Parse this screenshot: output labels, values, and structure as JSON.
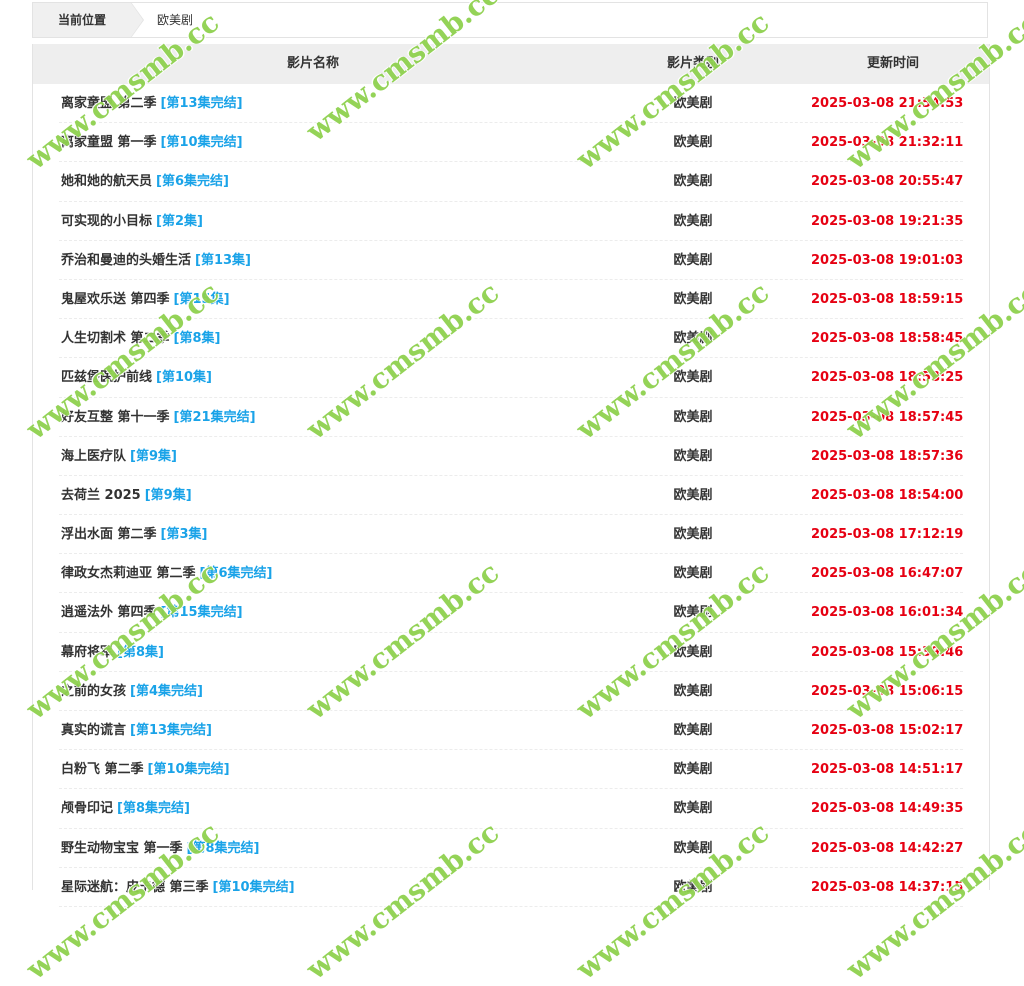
{
  "breadcrumb": {
    "label": "当前位置",
    "current": "欧美剧"
  },
  "table": {
    "headers": {
      "name": "影片名称",
      "type": "影片类别",
      "time": "更新时间"
    },
    "rows": [
      {
        "title": "离家童盟 第二季",
        "episode": "[第13集完结]",
        "type": "欧美剧",
        "time": "2025-03-08 21:54:53"
      },
      {
        "title": "离家童盟 第一季",
        "episode": "[第10集完结]",
        "type": "欧美剧",
        "time": "2025-03-08 21:32:11"
      },
      {
        "title": "她和她的航天员",
        "episode": "[第6集完结]",
        "type": "欧美剧",
        "time": "2025-03-08 20:55:47"
      },
      {
        "title": "可实现的小目标",
        "episode": "[第2集]",
        "type": "欧美剧",
        "time": "2025-03-08 19:21:35"
      },
      {
        "title": "乔治和曼迪的头婚生活",
        "episode": "[第13集]",
        "type": "欧美剧",
        "time": "2025-03-08 19:01:03"
      },
      {
        "title": "鬼屋欢乐送 第四季",
        "episode": "[第15集]",
        "type": "欧美剧",
        "time": "2025-03-08 18:59:15"
      },
      {
        "title": "人生切割术 第二季",
        "episode": "[第8集]",
        "type": "欧美剧",
        "time": "2025-03-08 18:58:45"
      },
      {
        "title": "匹兹堡医护前线",
        "episode": "[第10集]",
        "type": "欧美剧",
        "time": "2025-03-08 18:58:25"
      },
      {
        "title": "好友互整 第十一季",
        "episode": "[第21集完结]",
        "type": "欧美剧",
        "time": "2025-03-08 18:57:45"
      },
      {
        "title": "海上医疗队",
        "episode": "[第9集]",
        "type": "欧美剧",
        "time": "2025-03-08 18:57:36"
      },
      {
        "title": "去荷兰 2025",
        "episode": "[第9集]",
        "type": "欧美剧",
        "time": "2025-03-08 18:54:00"
      },
      {
        "title": "浮出水面 第二季",
        "episode": "[第3集]",
        "type": "欧美剧",
        "time": "2025-03-08 17:12:19"
      },
      {
        "title": "律政女杰莉迪亚 第二季",
        "episode": "[第6集完结]",
        "type": "欧美剧",
        "time": "2025-03-08 16:47:07"
      },
      {
        "title": "逍遥法外 第四季",
        "episode": "[第15集完结]",
        "type": "欧美剧",
        "time": "2025-03-08 16:01:34"
      },
      {
        "title": "幕府将军",
        "episode": "[第8集]",
        "type": "欧美剧",
        "time": "2025-03-08 15:39:46"
      },
      {
        "title": "之前的女孩",
        "episode": "[第4集完结]",
        "type": "欧美剧",
        "time": "2025-03-08 15:06:15"
      },
      {
        "title": "真实的谎言",
        "episode": "[第13集完结]",
        "type": "欧美剧",
        "time": "2025-03-08 15:02:17"
      },
      {
        "title": "白粉飞 第二季",
        "episode": "[第10集完结]",
        "type": "欧美剧",
        "time": "2025-03-08 14:51:17"
      },
      {
        "title": "颅骨印记",
        "episode": "[第8集完结]",
        "type": "欧美剧",
        "time": "2025-03-08 14:49:35"
      },
      {
        "title": "野生动物宝宝 第一季",
        "episode": "[第8集完结]",
        "type": "欧美剧",
        "time": "2025-03-08 14:42:27"
      },
      {
        "title": "星际迷航：皮卡德 第三季",
        "episode": "[第10集完结]",
        "type": "欧美剧",
        "time": "2025-03-08 14:37:15"
      }
    ]
  },
  "watermark": {
    "text": "www.cmsmb.cc",
    "color": "#8fd14f"
  },
  "colors": {
    "episode": "#1aa3e8",
    "time": "#e60012",
    "header_bg": "#eeeeee"
  }
}
